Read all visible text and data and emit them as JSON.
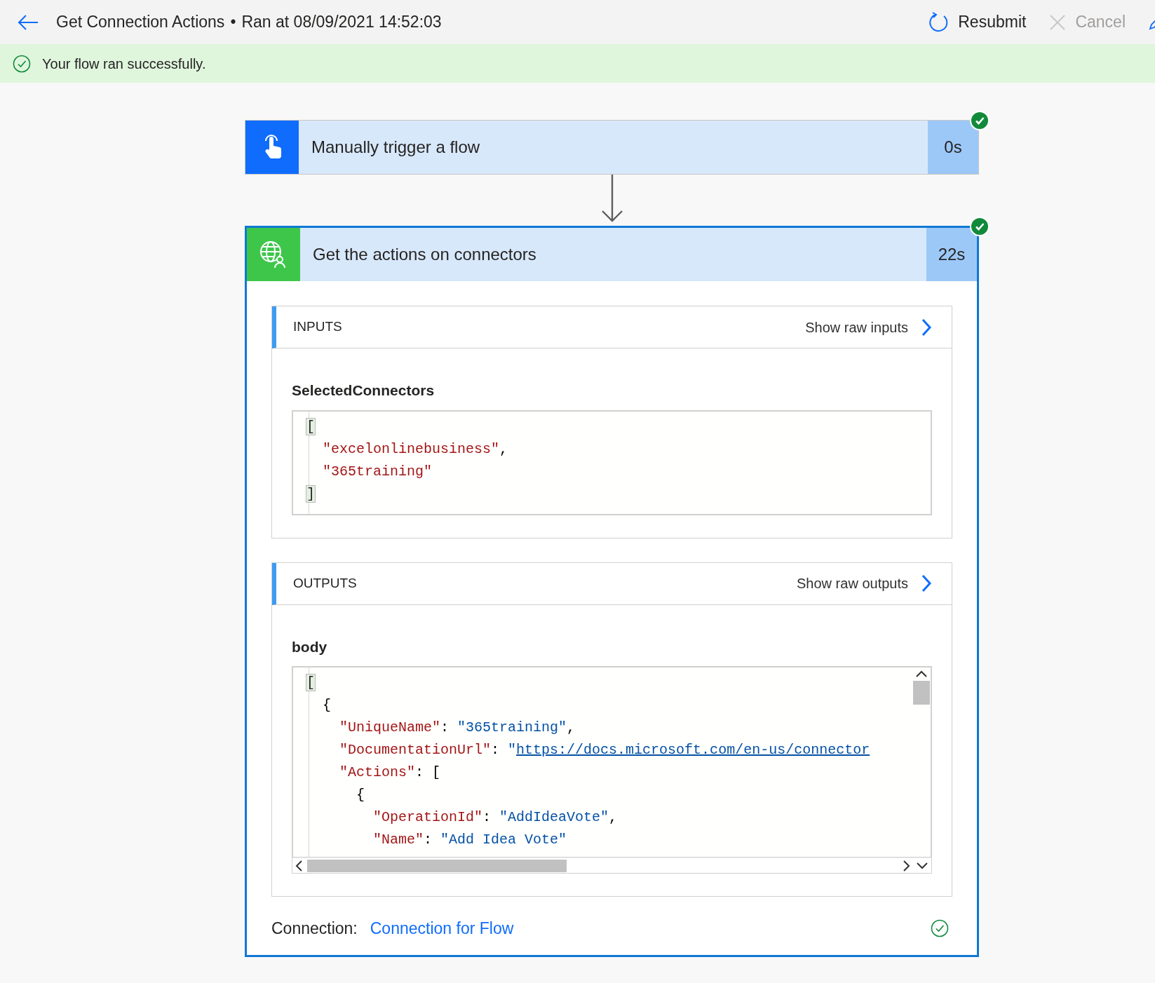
{
  "header": {
    "title": "Get Connection Actions",
    "separator": "•",
    "run_info": "Ran at 08/09/2021 14:52:03",
    "actions": [
      {
        "kind": "resubmit",
        "label": "Resubmit",
        "disabled": false
      },
      {
        "kind": "cancel",
        "label": "Cancel",
        "disabled": true
      },
      {
        "kind": "edit",
        "disabled": false
      }
    ]
  },
  "status_banner": {
    "message": "Your flow ran successfully."
  },
  "steps": [
    {
      "kind": "trigger",
      "title": "Manually trigger a flow",
      "duration": "0s",
      "succeeded": true,
      "selected": false,
      "color": "#0f6cfc"
    },
    {
      "kind": "action",
      "title": "Get the actions on connectors",
      "duration": "22s",
      "succeeded": true,
      "selected": true,
      "color": "#3ec64b",
      "sections": [
        {
          "kind": "static",
          "heading": "INPUTS",
          "raw_link": "Show raw inputs",
          "field_label": "SelectedConnectors",
          "code": [
            {
              "parts": [
                {
                  "kind": "bracket",
                  "text": "["
                }
              ],
              "children": [
                {
                  "parts": [
                    {
                      "kind": "string",
                      "text": "\"excelonlinebusiness\""
                    },
                    {
                      "kind": "punct",
                      "text": ","
                    }
                  ]
                },
                {
                  "parts": [
                    {
                      "kind": "string",
                      "text": "\"365training\""
                    }
                  ]
                }
              ]
            },
            {
              "parts": [
                {
                  "kind": "bracket",
                  "text": "]"
                }
              ]
            }
          ]
        },
        {
          "kind": "scrolling",
          "heading": "OUTPUTS",
          "raw_link": "Show raw outputs",
          "field_label": "body",
          "code": [
            {
              "parts": [
                {
                  "kind": "bracket",
                  "text": "["
                }
              ],
              "children": [
                {
                  "parts": [
                    {
                      "kind": "punct",
                      "text": "{"
                    }
                  ],
                  "children": [
                    {
                      "parts": [
                        {
                          "kind": "string",
                          "text": "\"UniqueName\""
                        },
                        {
                          "kind": "punct",
                          "text": ": "
                        },
                        {
                          "kind": "value",
                          "text": "\"365training\""
                        },
                        {
                          "kind": "punct",
                          "text": ","
                        }
                      ]
                    },
                    {
                      "parts": [
                        {
                          "kind": "string",
                          "text": "\"DocumentationUrl\""
                        },
                        {
                          "kind": "punct",
                          "text": ": "
                        },
                        {
                          "kind": "value",
                          "text": "\""
                        },
                        {
                          "kind": "link",
                          "text": "https://docs.microsoft.com/en-us/connector"
                        }
                      ]
                    },
                    {
                      "parts": [
                        {
                          "kind": "string",
                          "text": "\"Actions\""
                        },
                        {
                          "kind": "punct",
                          "text": ": ["
                        }
                      ],
                      "children": [
                        {
                          "parts": [
                            {
                              "kind": "punct",
                              "text": "{"
                            }
                          ],
                          "children": [
                            {
                              "parts": [
                                {
                                  "kind": "string",
                                  "text": "\"OperationId\""
                                },
                                {
                                  "kind": "punct",
                                  "text": ": "
                                },
                                {
                                  "kind": "value",
                                  "text": "\"AddIdeaVote\""
                                },
                                {
                                  "kind": "punct",
                                  "text": ","
                                }
                              ]
                            },
                            {
                              "parts": [
                                {
                                  "kind": "string",
                                  "text": "\"Name\""
                                },
                                {
                                  "kind": "punct",
                                  "text": ": "
                                },
                                {
                                  "kind": "value",
                                  "text": "\"Add Idea Vote\""
                                }
                              ]
                            }
                          ]
                        }
                      ]
                    }
                  ]
                }
              ]
            }
          ]
        }
      ],
      "connection": {
        "label": "Connection:",
        "link": "Connection for Flow",
        "verified": true
      }
    }
  ]
}
